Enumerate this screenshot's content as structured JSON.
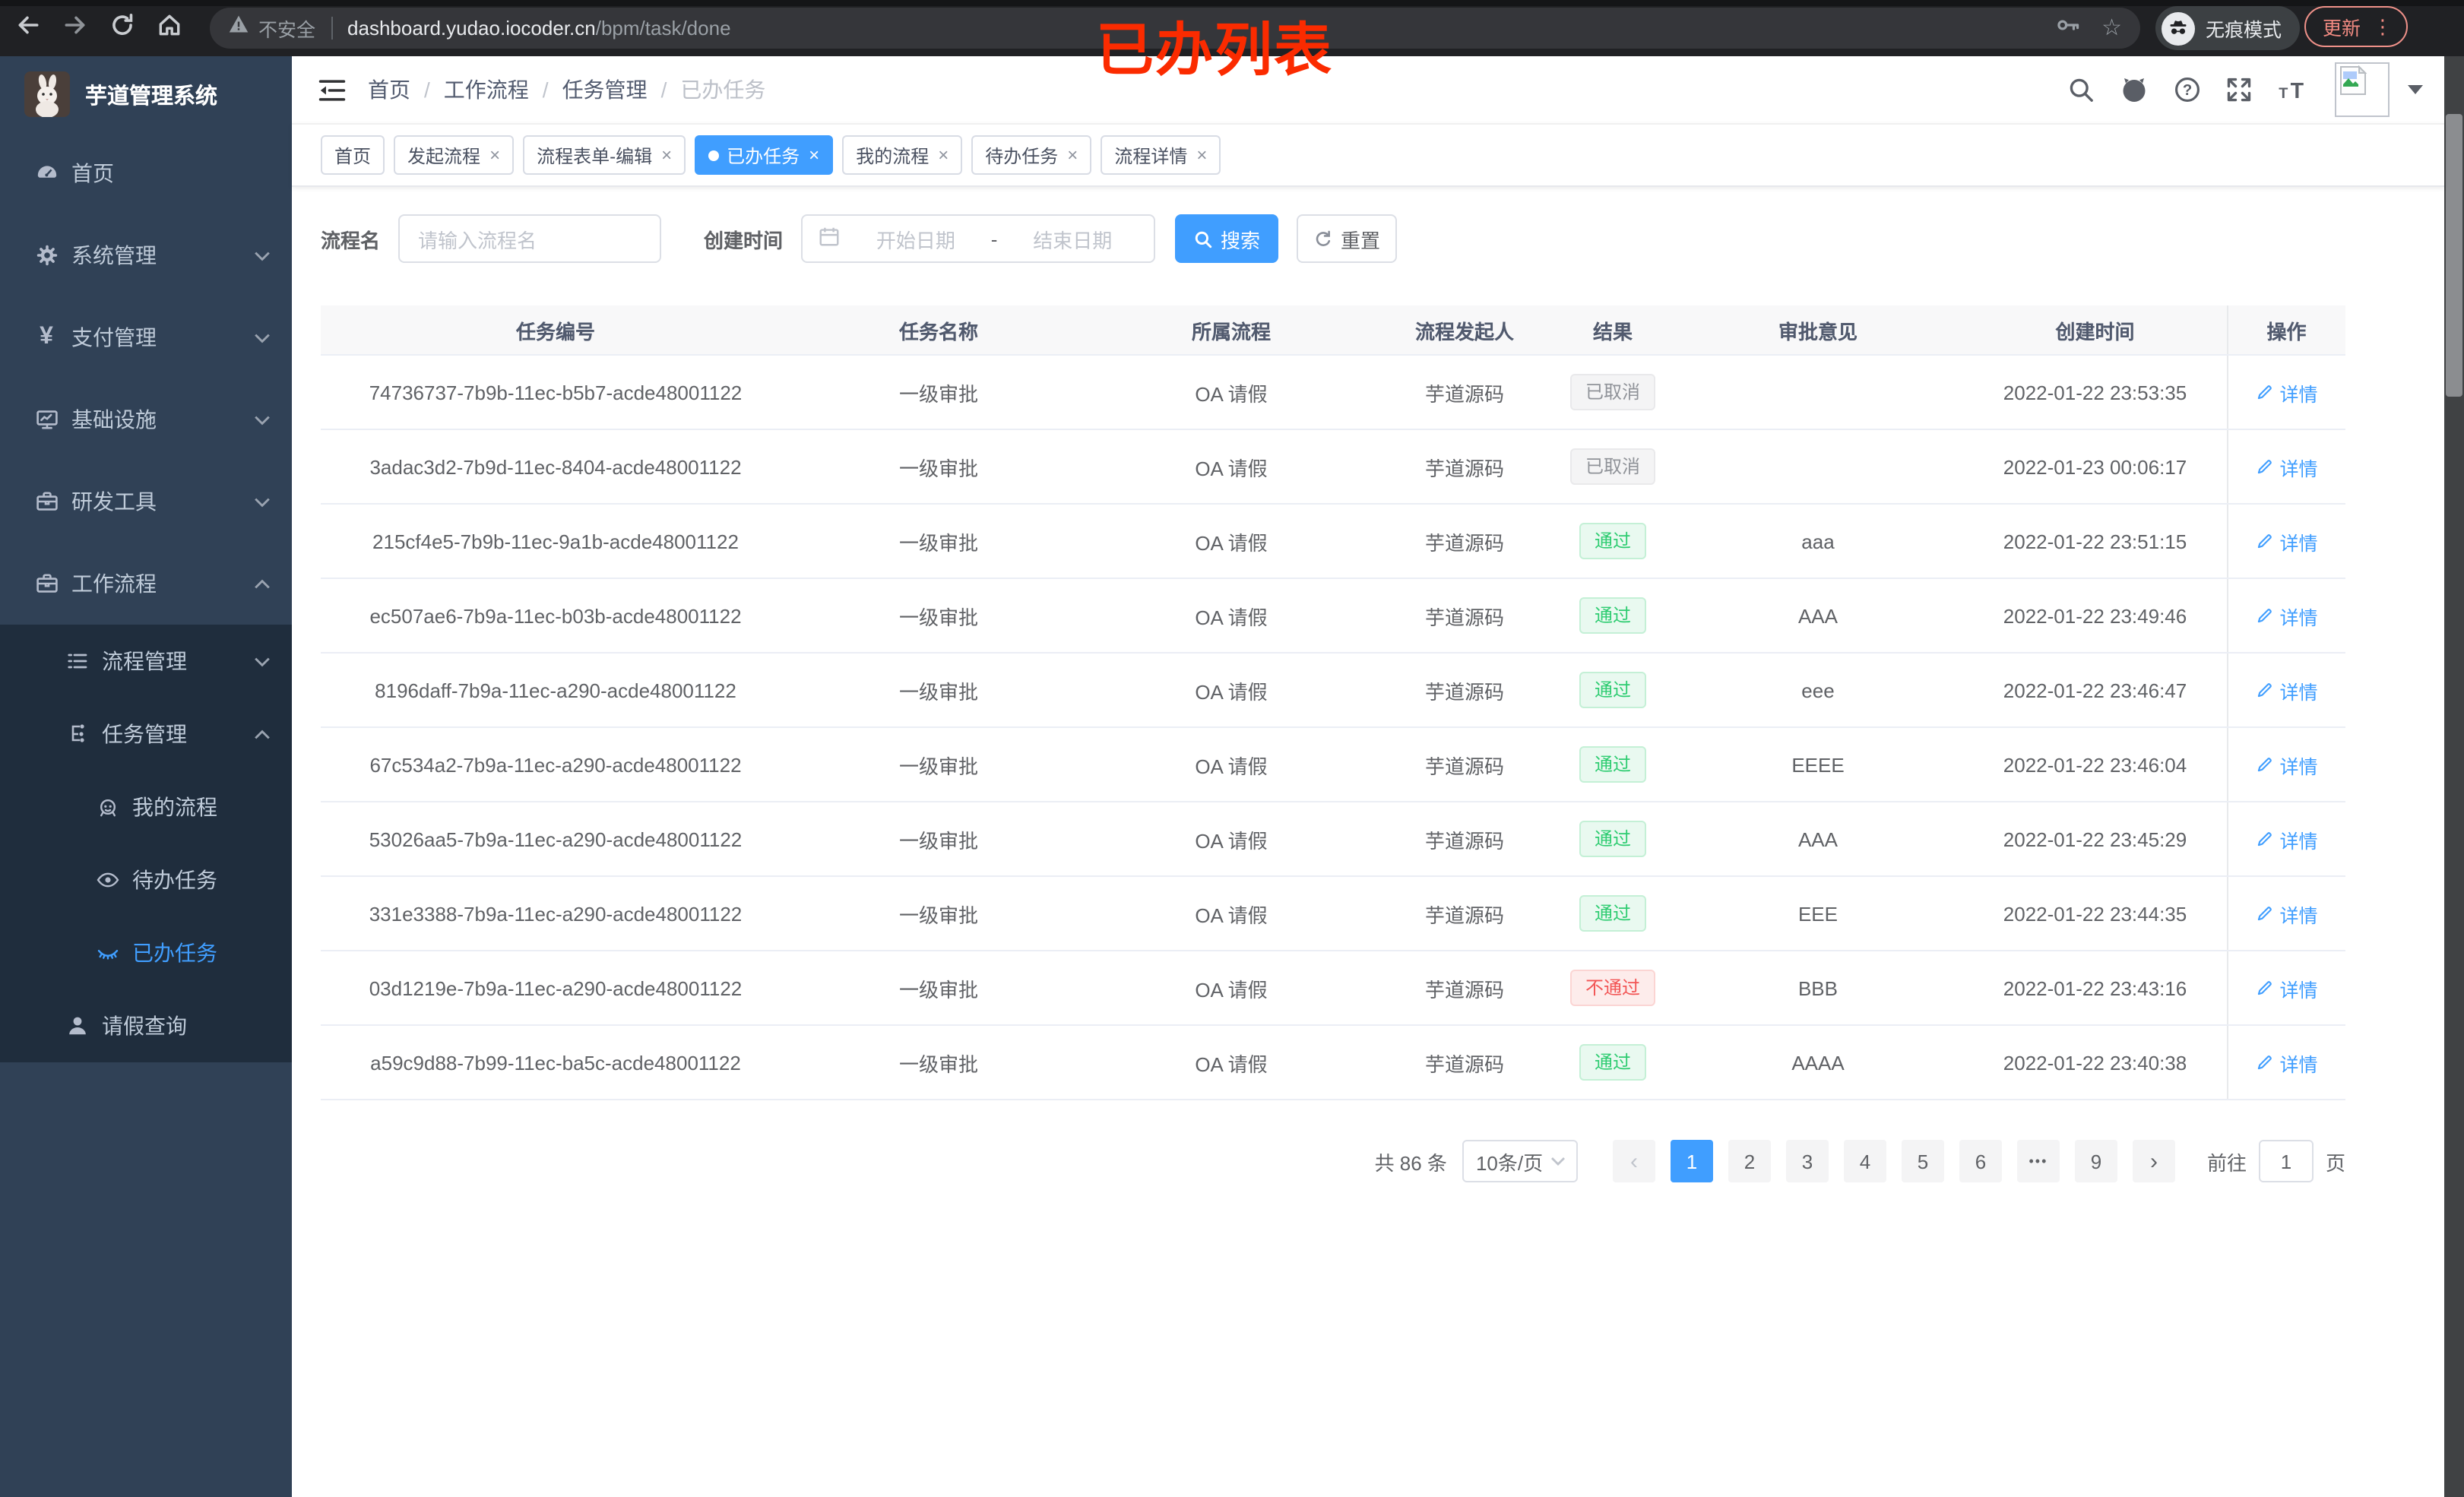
{
  "browser": {
    "security_label": "不安全",
    "url_host": "dashboard.yudao.iocoder.cn",
    "url_path": "/bpm/task/done",
    "incognito_label": "无痕模式",
    "update_label": "更新",
    "menu_dots": "⋮",
    "bookmark_star": "☆"
  },
  "annotation": {
    "text": "已办列表",
    "color": "#fb2b00"
  },
  "sidebar": {
    "title": "芋道管理系统",
    "items": [
      {
        "label": "首页",
        "icon": "gauge-icon",
        "level": 1
      },
      {
        "label": "系统管理",
        "icon": "gear-icon",
        "level": 1,
        "chevron": "down"
      },
      {
        "label": "支付管理",
        "icon": "yen-icon",
        "level": 1,
        "chevron": "down"
      },
      {
        "label": "基础设施",
        "icon": "monitor-icon",
        "level": 1,
        "chevron": "down"
      },
      {
        "label": "研发工具",
        "icon": "toolbox-icon",
        "level": 1,
        "chevron": "down"
      },
      {
        "label": "工作流程",
        "icon": "briefcase-icon",
        "level": 1,
        "chevron": "up"
      },
      {
        "label": "流程管理",
        "icon": "list-icon",
        "level": 2,
        "chevron": "down",
        "sub": true
      },
      {
        "label": "任务管理",
        "icon": "tree-icon",
        "level": 2,
        "chevron": "up",
        "sub": true
      },
      {
        "label": "我的流程",
        "icon": "robot-icon",
        "level": 3,
        "sub": true
      },
      {
        "label": "待办任务",
        "icon": "eye-open-icon",
        "level": 3,
        "sub": true
      },
      {
        "label": "已办任务",
        "icon": "eye-closed-icon",
        "level": 3,
        "sub": true,
        "active": true
      },
      {
        "label": "请假查询",
        "icon": "user-icon",
        "level": 2,
        "sub": true
      }
    ]
  },
  "header": {
    "breadcrumb": [
      "首页",
      "工作流程",
      "任务管理",
      "已办任务"
    ],
    "separator": "/"
  },
  "tabs": [
    {
      "label": "首页"
    },
    {
      "label": "发起流程",
      "closable": true
    },
    {
      "label": "流程表单-编辑",
      "closable": true
    },
    {
      "label": "已办任务",
      "closable": true,
      "active": true
    },
    {
      "label": "我的流程",
      "closable": true
    },
    {
      "label": "待办任务",
      "closable": true
    },
    {
      "label": "流程详情",
      "closable": true
    }
  ],
  "filters": {
    "name_label": "流程名",
    "name_placeholder": "请输入流程名",
    "date_label": "创建时间",
    "date_start_placeholder": "开始日期",
    "date_separator": "-",
    "date_end_placeholder": "结束日期",
    "search_label": "搜索",
    "reset_label": "重置"
  },
  "table": {
    "columns": [
      "任务编号",
      "任务名称",
      "所属流程",
      "流程发起人",
      "结果",
      "审批意见",
      "创建时间",
      "操作"
    ],
    "detail_label": "详情",
    "rows": [
      {
        "id": "74736737-7b9b-11ec-b5b7-acde48001122",
        "name": "一级审批",
        "process": "OA 请假",
        "starter": "芋道源码",
        "result": "已取消",
        "result_type": "info",
        "comment": "",
        "time": "2022-01-22 23:53:35"
      },
      {
        "id": "3adac3d2-7b9d-11ec-8404-acde48001122",
        "name": "一级审批",
        "process": "OA 请假",
        "starter": "芋道源码",
        "result": "已取消",
        "result_type": "info",
        "comment": "",
        "time": "2022-01-23 00:06:17"
      },
      {
        "id": "215cf4e5-7b9b-11ec-9a1b-acde48001122",
        "name": "一级审批",
        "process": "OA 请假",
        "starter": "芋道源码",
        "result": "通过",
        "result_type": "success",
        "comment": "aaa",
        "time": "2022-01-22 23:51:15"
      },
      {
        "id": "ec507ae6-7b9a-11ec-b03b-acde48001122",
        "name": "一级审批",
        "process": "OA 请假",
        "starter": "芋道源码",
        "result": "通过",
        "result_type": "success",
        "comment": "AAA",
        "time": "2022-01-22 23:49:46"
      },
      {
        "id": "8196daff-7b9a-11ec-a290-acde48001122",
        "name": "一级审批",
        "process": "OA 请假",
        "starter": "芋道源码",
        "result": "通过",
        "result_type": "success",
        "comment": "eee",
        "time": "2022-01-22 23:46:47"
      },
      {
        "id": "67c534a2-7b9a-11ec-a290-acde48001122",
        "name": "一级审批",
        "process": "OA 请假",
        "starter": "芋道源码",
        "result": "通过",
        "result_type": "success",
        "comment": "EEEE",
        "time": "2022-01-22 23:46:04"
      },
      {
        "id": "53026aa5-7b9a-11ec-a290-acde48001122",
        "name": "一级审批",
        "process": "OA 请假",
        "starter": "芋道源码",
        "result": "通过",
        "result_type": "success",
        "comment": "AAA",
        "time": "2022-01-22 23:45:29"
      },
      {
        "id": "331e3388-7b9a-11ec-a290-acde48001122",
        "name": "一级审批",
        "process": "OA 请假",
        "starter": "芋道源码",
        "result": "通过",
        "result_type": "success",
        "comment": "EEE",
        "time": "2022-01-22 23:44:35"
      },
      {
        "id": "03d1219e-7b9a-11ec-a290-acde48001122",
        "name": "一级审批",
        "process": "OA 请假",
        "starter": "芋道源码",
        "result": "不通过",
        "result_type": "danger",
        "comment": "BBB",
        "time": "2022-01-22 23:43:16"
      },
      {
        "id": "a59c9d88-7b99-11ec-ba5c-acde48001122",
        "name": "一级审批",
        "process": "OA 请假",
        "starter": "芋道源码",
        "result": "通过",
        "result_type": "success",
        "comment": "AAAA",
        "time": "2022-01-22 23:40:38"
      }
    ]
  },
  "pagination": {
    "total_label": "共 86 条",
    "page_size": "10条/页",
    "pages": [
      "1",
      "2",
      "3",
      "4",
      "5",
      "6",
      "•••",
      "9"
    ],
    "active_page": "1",
    "goto_label": "前往",
    "goto_value": "1",
    "page_unit": "页"
  },
  "colors": {
    "primary": "#409eff",
    "sidebar_bg": "#304156",
    "submenu_bg": "#1f2d3d",
    "success_text": "#2ecc71",
    "danger_text": "#f25555",
    "info_text": "#909399",
    "annotation_red": "#fb2b00"
  }
}
